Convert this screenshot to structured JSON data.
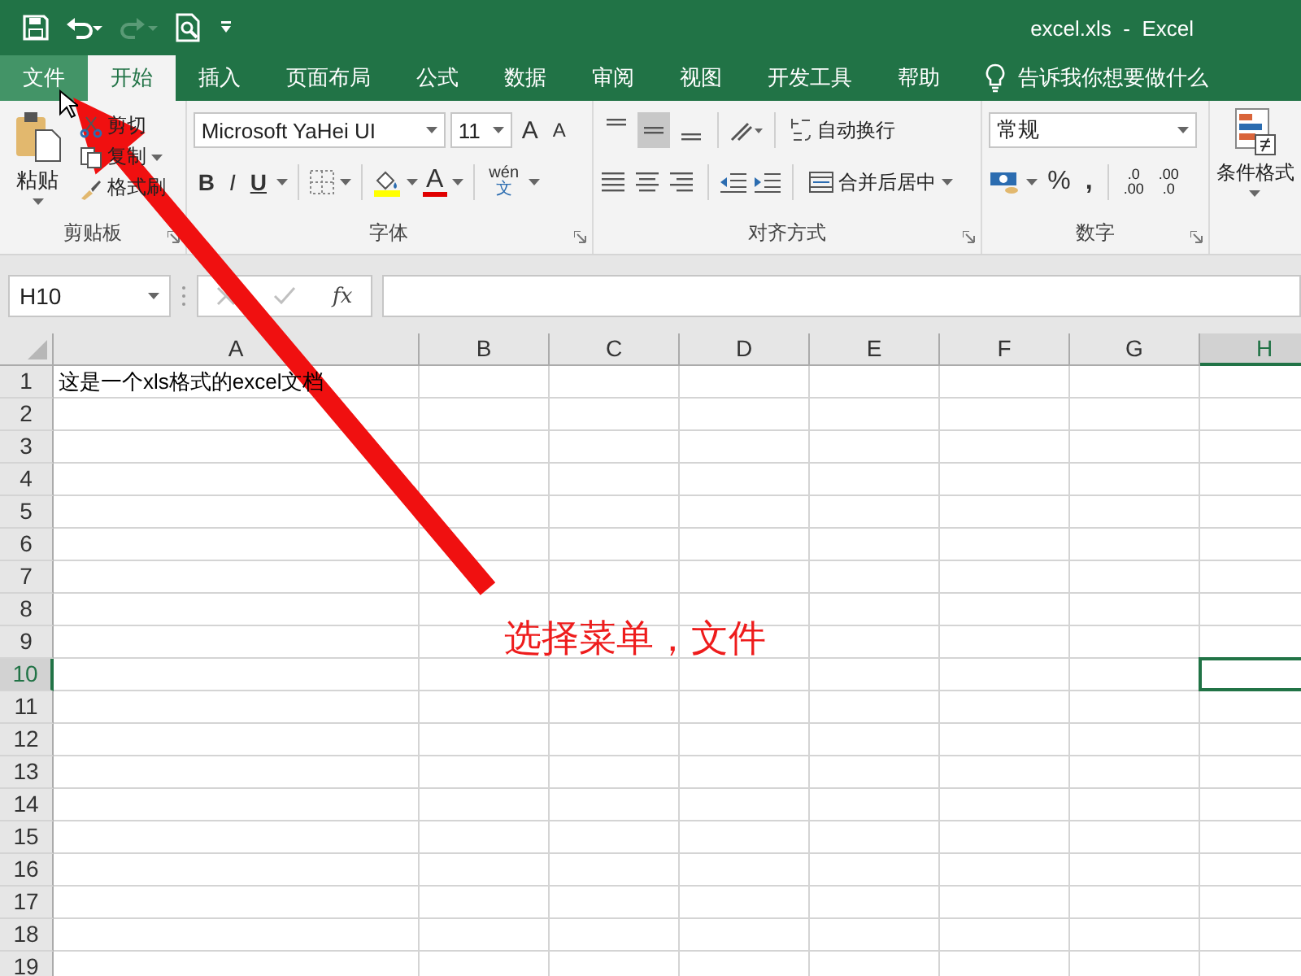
{
  "window": {
    "title": "excel.xls  -  Excel"
  },
  "tabs": [
    {
      "label": "文件",
      "selected": false,
      "hovered": true
    },
    {
      "label": "开始",
      "selected": true,
      "hovered": false
    },
    {
      "label": "插入",
      "selected": false,
      "hovered": false
    },
    {
      "label": "页面布局",
      "selected": false,
      "hovered": false
    },
    {
      "label": "公式",
      "selected": false,
      "hovered": false
    },
    {
      "label": "数据",
      "selected": false,
      "hovered": false
    },
    {
      "label": "审阅",
      "selected": false,
      "hovered": false
    },
    {
      "label": "视图",
      "selected": false,
      "hovered": false
    },
    {
      "label": "开发工具",
      "selected": false,
      "hovered": false
    },
    {
      "label": "帮助",
      "selected": false,
      "hovered": false
    }
  ],
  "tell_me": "告诉我你想要做什么",
  "clipboard": {
    "title": "剪贴板",
    "paste": "粘贴",
    "cut": "剪切",
    "copy": "复制",
    "format_painter": "格式刷"
  },
  "font": {
    "title": "字体",
    "font_name": "Microsoft YaHei UI",
    "font_size": "11",
    "grow": "A",
    "shrink": "A",
    "bold": "B",
    "italic": "I",
    "underline": "U",
    "font_color": "A",
    "phonetic_top": "wén",
    "phonetic_bottom": "文"
  },
  "alignment": {
    "title": "对齐方式",
    "vertical_align": [
      {
        "selected": false
      },
      {
        "selected": true
      },
      {
        "selected": false
      }
    ],
    "wrap_text": "自动换行",
    "merge_center": "合并后居中"
  },
  "number": {
    "title": "数字",
    "format": "常规",
    "percent": "%",
    "comma": ",",
    "increase_decimal": [
      ".0",
      ".00"
    ],
    "decrease_decimal": [
      ".00",
      ".0"
    ]
  },
  "styles": {
    "conditional_format": "条件格式"
  },
  "formula_bar": {
    "name_box": "H10",
    "function_label": "fx"
  },
  "columns": [
    {
      "label": "A",
      "selected": false
    },
    {
      "label": "B",
      "selected": false
    },
    {
      "label": "C",
      "selected": false
    },
    {
      "label": "D",
      "selected": false
    },
    {
      "label": "E",
      "selected": false
    },
    {
      "label": "F",
      "selected": false
    },
    {
      "label": "G",
      "selected": false
    },
    {
      "label": "H",
      "selected": true
    }
  ],
  "rows": [
    {
      "label": "1",
      "selected": false,
      "value": "这是一个xls格式的excel文档"
    },
    {
      "label": "2",
      "selected": false
    },
    {
      "label": "3",
      "selected": false
    },
    {
      "label": "4",
      "selected": false
    },
    {
      "label": "5",
      "selected": false
    },
    {
      "label": "6",
      "selected": false
    },
    {
      "label": "7",
      "selected": false
    },
    {
      "label": "8",
      "selected": false
    },
    {
      "label": "9",
      "selected": false
    },
    {
      "label": "10",
      "selected": true
    },
    {
      "label": "11",
      "selected": false
    },
    {
      "label": "12",
      "selected": false
    },
    {
      "label": "13",
      "selected": false
    },
    {
      "label": "14",
      "selected": false
    },
    {
      "label": "15",
      "selected": false
    },
    {
      "label": "16",
      "selected": false
    },
    {
      "label": "17",
      "selected": false
    },
    {
      "label": "18",
      "selected": false
    },
    {
      "label": "19",
      "selected": false
    }
  ],
  "annotation": {
    "text": "选择菜单，文件"
  }
}
